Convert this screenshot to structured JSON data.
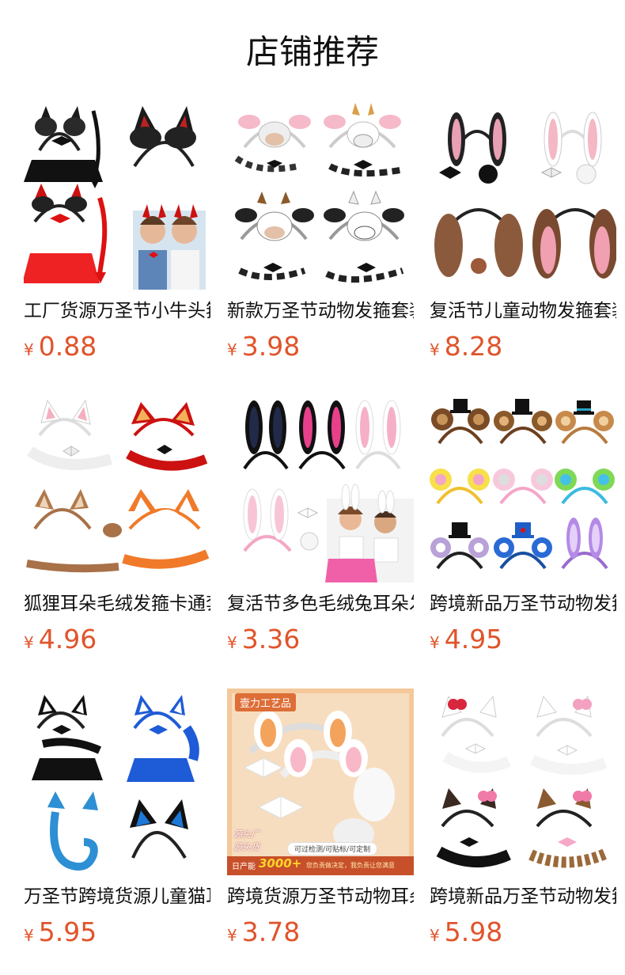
{
  "page": {
    "title": "店铺推荐"
  },
  "products": [
    {
      "name": "工厂货源万圣节小牛头箍",
      "currency": "¥",
      "price": "0.88",
      "image": "devil-costume-set",
      "accent": "#1a1a1a"
    },
    {
      "name": "新款万圣节动物发箍套装",
      "currency": "¥",
      "price": "3.98",
      "image": "cow-headband-set",
      "accent": "#f4b8c8"
    },
    {
      "name": "复活节儿童动物发箍套装",
      "currency": "¥",
      "price": "8.28",
      "image": "bunny-dog-ear-set",
      "accent": "#8b5a3c"
    },
    {
      "name": "狐狸耳朵毛绒发箍卡通套装",
      "currency": "¥",
      "price": "4.96",
      "image": "fox-ear-set",
      "accent": "#f07a2a"
    },
    {
      "name": "复活节多色毛绒兔耳朵发箍",
      "currency": "¥",
      "price": "3.36",
      "image": "bunny-ear-headbands",
      "accent": "#e8408a"
    },
    {
      "name": "跨境新品万圣节动物发箍",
      "currency": "¥",
      "price": "4.95",
      "image": "bear-ear-headbands",
      "accent": "#8b5a2b"
    },
    {
      "name": "万圣节跨境货源儿童猫耳套装",
      "currency": "¥",
      "price": "5.95",
      "image": "cat-costume-set",
      "accent": "#1e5bd6"
    },
    {
      "name": "跨境货源万圣节动物耳朵套装",
      "currency": "¥",
      "price": "3.78",
      "image": "factory-photo-headbands",
      "accent": "#f3a35c",
      "banner": {
        "brand": "壹力工艺品",
        "tag1": "源头厂",
        "tag2": "源头货",
        "capacity": "日产能",
        "capacity_value": "3000+",
        "service": "可过检测/可贴标/可定制",
        "promise": "您负责做决定，我负责让您满意"
      }
    },
    {
      "name": "跨境新品万圣节动物发箍套装",
      "currency": "¥",
      "price": "5.98",
      "image": "kitty-headband-set",
      "accent": "#d8263c"
    }
  ]
}
